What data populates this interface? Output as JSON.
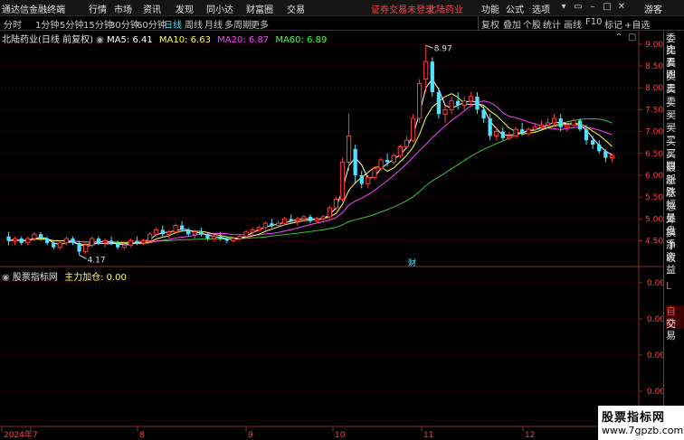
{
  "app": {
    "title": "通达信金融终端",
    "menus": [
      "行情",
      "市场",
      "资讯",
      "发现",
      "同小达",
      "财富圈",
      "交易"
    ],
    "notice": "证券交易未登录",
    "stock_name": "北陆药业",
    "right_menus": [
      "功能",
      "公式",
      "选项"
    ],
    "user": "游客"
  },
  "toolbar": {
    "timeframes": [
      "分时",
      "1分钟",
      "5分钟",
      "15分钟",
      "30分钟",
      "60分钟",
      "日线",
      "周线",
      "月线",
      "多周期",
      "更多"
    ],
    "active_timeframe": "日线",
    "tools": [
      "复权",
      "叠加",
      "个股",
      "统计",
      "画线",
      "F10",
      "标记"
    ],
    "last_tool": "+自选"
  },
  "chart_header": {
    "title": "北陆药业(日线 前复权)",
    "ma": [
      {
        "label": "MA5: 6.41",
        "color": "#ffffff"
      },
      {
        "label": "MA10: 6.63",
        "color": "#ffff40"
      },
      {
        "label": "MA20: 6.87",
        "color": "#ff40ff"
      },
      {
        "label": "MA60: 6.89",
        "color": "#40ff40"
      }
    ]
  },
  "lower_header": {
    "title": "股票指标网",
    "indicator": "主力加仓: 0.00"
  },
  "chart_data": {
    "type": "candlestick",
    "price_axis": [
      "9.00",
      "8.50",
      "8.00",
      "7.50",
      "7.00",
      "6.50",
      "6.00",
      "5.50",
      "5.00",
      "4.50"
    ],
    "ylim": [
      4.2,
      9.1
    ],
    "high_label": "8.97",
    "low_label": "4.17",
    "marker": "财",
    "indicator_axis": [
      "0.00",
      "0.00",
      "0.00",
      "0.00",
      "0.00"
    ],
    "x_labels": [
      "2024年",
      "7",
      "8",
      "9",
      "10",
      "11",
      "12"
    ],
    "colors": {
      "up": "#ff3b3b",
      "down": "#4fe3ff",
      "ma5": "#ffffff",
      "ma10": "#ffff40",
      "ma20": "#ff40ff",
      "ma60": "#40c040"
    },
    "candles": [
      [
        4.6,
        4.7,
        4.4,
        4.5
      ],
      [
        4.5,
        4.6,
        4.4,
        4.55
      ],
      [
        4.55,
        4.6,
        4.4,
        4.45
      ],
      [
        4.45,
        4.6,
        4.4,
        4.55
      ],
      [
        4.55,
        4.7,
        4.5,
        4.65
      ],
      [
        4.65,
        4.7,
        4.5,
        4.55
      ],
      [
        4.55,
        4.6,
        4.4,
        4.45
      ],
      [
        4.45,
        4.5,
        4.3,
        4.35
      ],
      [
        4.35,
        4.5,
        4.3,
        4.45
      ],
      [
        4.45,
        4.6,
        4.4,
        4.55
      ],
      [
        4.55,
        4.6,
        4.4,
        4.45
      ],
      [
        4.45,
        4.5,
        4.17,
        4.25
      ],
      [
        4.25,
        4.45,
        4.2,
        4.4
      ],
      [
        4.4,
        4.6,
        4.35,
        4.55
      ],
      [
        4.55,
        4.6,
        4.4,
        4.45
      ],
      [
        4.45,
        4.55,
        4.35,
        4.5
      ],
      [
        4.5,
        4.6,
        4.4,
        4.45
      ],
      [
        4.45,
        4.5,
        4.3,
        4.35
      ],
      [
        4.35,
        4.45,
        4.3,
        4.4
      ],
      [
        4.4,
        4.55,
        4.35,
        4.5
      ],
      [
        4.5,
        4.6,
        4.4,
        4.45
      ],
      [
        4.45,
        4.55,
        4.4,
        4.5
      ],
      [
        4.5,
        4.7,
        4.45,
        4.65
      ],
      [
        4.65,
        4.8,
        4.6,
        4.75
      ],
      [
        4.75,
        4.85,
        4.6,
        4.65
      ],
      [
        4.65,
        4.75,
        4.55,
        4.7
      ],
      [
        4.7,
        4.9,
        4.65,
        4.85
      ],
      [
        4.85,
        4.95,
        4.7,
        4.75
      ],
      [
        4.75,
        4.8,
        4.6,
        4.65
      ],
      [
        4.65,
        4.75,
        4.55,
        4.7
      ],
      [
        4.7,
        4.8,
        4.6,
        4.65
      ],
      [
        4.65,
        4.7,
        4.5,
        4.55
      ],
      [
        4.55,
        4.65,
        4.5,
        4.6
      ],
      [
        4.6,
        4.7,
        4.5,
        4.55
      ],
      [
        4.55,
        4.6,
        4.45,
        4.5
      ],
      [
        4.5,
        4.6,
        4.45,
        4.55
      ],
      [
        4.55,
        4.65,
        4.5,
        4.6
      ],
      [
        4.6,
        4.75,
        4.55,
        4.7
      ],
      [
        4.7,
        4.8,
        4.6,
        4.75
      ],
      [
        4.75,
        4.85,
        4.7,
        4.8
      ],
      [
        4.8,
        4.95,
        4.75,
        4.9
      ],
      [
        4.9,
        5.0,
        4.8,
        4.85
      ],
      [
        4.85,
        4.95,
        4.8,
        4.9
      ],
      [
        4.9,
        5.05,
        4.85,
        5.0
      ],
      [
        5.0,
        5.1,
        4.9,
        4.95
      ],
      [
        4.95,
        5.05,
        4.85,
        5.0
      ],
      [
        5.0,
        5.1,
        4.95,
        5.05
      ],
      [
        5.05,
        5.1,
        4.9,
        4.95
      ],
      [
        4.95,
        5.05,
        4.9,
        5.0
      ],
      [
        5.0,
        5.1,
        4.95,
        5.05
      ],
      [
        5.05,
        5.3,
        5.0,
        5.25
      ],
      [
        5.25,
        5.5,
        5.2,
        5.45
      ],
      [
        5.45,
        6.4,
        5.4,
        6.3
      ],
      [
        6.3,
        7.4,
        6.1,
        6.9
      ],
      [
        6.6,
        6.7,
        5.8,
        6.0
      ],
      [
        6.0,
        6.1,
        5.7,
        5.8
      ],
      [
        5.8,
        6.0,
        5.7,
        5.95
      ],
      [
        5.95,
        6.2,
        5.9,
        6.15
      ],
      [
        6.15,
        6.4,
        6.1,
        6.35
      ],
      [
        6.35,
        6.5,
        6.2,
        6.3
      ],
      [
        6.3,
        6.5,
        6.25,
        6.45
      ],
      [
        6.45,
        6.7,
        6.4,
        6.65
      ],
      [
        6.65,
        6.9,
        6.6,
        6.8
      ],
      [
        6.8,
        7.4,
        6.75,
        7.3
      ],
      [
        7.3,
        8.2,
        7.2,
        8.1
      ],
      [
        8.2,
        8.97,
        7.9,
        8.6
      ],
      [
        8.6,
        8.7,
        7.8,
        7.9
      ],
      [
        7.9,
        8.0,
        7.3,
        7.4
      ],
      [
        7.4,
        7.6,
        7.2,
        7.5
      ],
      [
        7.5,
        7.8,
        7.4,
        7.7
      ],
      [
        7.7,
        7.9,
        7.5,
        7.6
      ],
      [
        7.6,
        7.8,
        7.5,
        7.7
      ],
      [
        7.7,
        7.9,
        7.6,
        7.8
      ],
      [
        7.8,
        7.9,
        7.4,
        7.5
      ],
      [
        7.5,
        7.6,
        7.2,
        7.3
      ],
      [
        7.3,
        7.4,
        6.8,
        6.9
      ],
      [
        6.9,
        7.1,
        6.8,
        7.0
      ],
      [
        7.0,
        7.1,
        6.8,
        6.85
      ],
      [
        6.85,
        7.0,
        6.8,
        6.9
      ],
      [
        6.9,
        7.1,
        6.85,
        7.05
      ],
      [
        7.05,
        7.2,
        6.9,
        6.95
      ],
      [
        6.95,
        7.1,
        6.9,
        7.05
      ],
      [
        7.05,
        7.2,
        7.0,
        7.1
      ],
      [
        7.1,
        7.25,
        7.05,
        7.15
      ],
      [
        7.15,
        7.3,
        7.1,
        7.2
      ],
      [
        7.2,
        7.4,
        7.1,
        7.3
      ],
      [
        7.3,
        7.4,
        7.0,
        7.1
      ],
      [
        7.1,
        7.2,
        7.0,
        7.15
      ],
      [
        7.15,
        7.3,
        7.1,
        7.25
      ],
      [
        7.25,
        7.3,
        7.0,
        7.05
      ],
      [
        7.05,
        7.15,
        6.7,
        6.8
      ],
      [
        6.8,
        6.9,
        6.6,
        6.7
      ],
      [
        6.7,
        6.8,
        6.5,
        6.55
      ],
      [
        6.55,
        6.6,
        6.3,
        6.4
      ],
      [
        6.4,
        6.5,
        6.3,
        6.45
      ]
    ]
  },
  "right_panel": {
    "items": [
      "委比",
      "卖五",
      "卖四",
      "卖三",
      "卖二",
      "卖一",
      "买一",
      "买二",
      "买三",
      "买四",
      "最新",
      "涨跌",
      "涨幅",
      "总量",
      "外盘",
      "换手",
      "净资",
      "收益"
    ],
    "lower_items": [
      "L",
      "自动",
      "交易"
    ]
  },
  "logo": {
    "line1": "股票指标网",
    "line2": "www.7gpzb.com"
  }
}
